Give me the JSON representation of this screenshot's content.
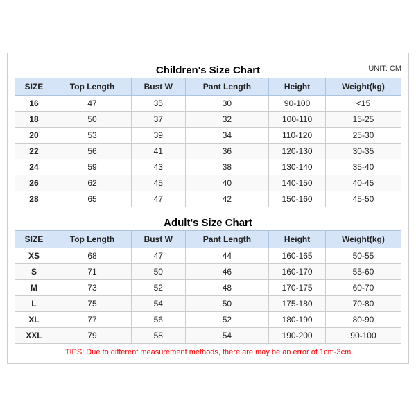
{
  "children_title": "Children's Size Chart",
  "adult_title": "Adult's Size Chart",
  "unit": "UNIT: CM",
  "headers": [
    "SIZE",
    "Top Length",
    "Bust W",
    "Pant Length",
    "Height",
    "Weight(kg)"
  ],
  "children_rows": [
    [
      "16",
      "47",
      "35",
      "30",
      "90-100",
      "<15"
    ],
    [
      "18",
      "50",
      "37",
      "32",
      "100-110",
      "15-25"
    ],
    [
      "20",
      "53",
      "39",
      "34",
      "110-120",
      "25-30"
    ],
    [
      "22",
      "56",
      "41",
      "36",
      "120-130",
      "30-35"
    ],
    [
      "24",
      "59",
      "43",
      "38",
      "130-140",
      "35-40"
    ],
    [
      "26",
      "62",
      "45",
      "40",
      "140-150",
      "40-45"
    ],
    [
      "28",
      "65",
      "47",
      "42",
      "150-160",
      "45-50"
    ]
  ],
  "adult_rows": [
    [
      "XS",
      "68",
      "47",
      "44",
      "160-165",
      "50-55"
    ],
    [
      "S",
      "71",
      "50",
      "46",
      "160-170",
      "55-60"
    ],
    [
      "M",
      "73",
      "52",
      "48",
      "170-175",
      "60-70"
    ],
    [
      "L",
      "75",
      "54",
      "50",
      "175-180",
      "70-80"
    ],
    [
      "XL",
      "77",
      "56",
      "52",
      "180-190",
      "80-90"
    ],
    [
      "XXL",
      "79",
      "58",
      "54",
      "190-200",
      "90-100"
    ]
  ],
  "tips": "TIPS: Due to different measurement methods, there are may be an error of 1cm-3cm"
}
